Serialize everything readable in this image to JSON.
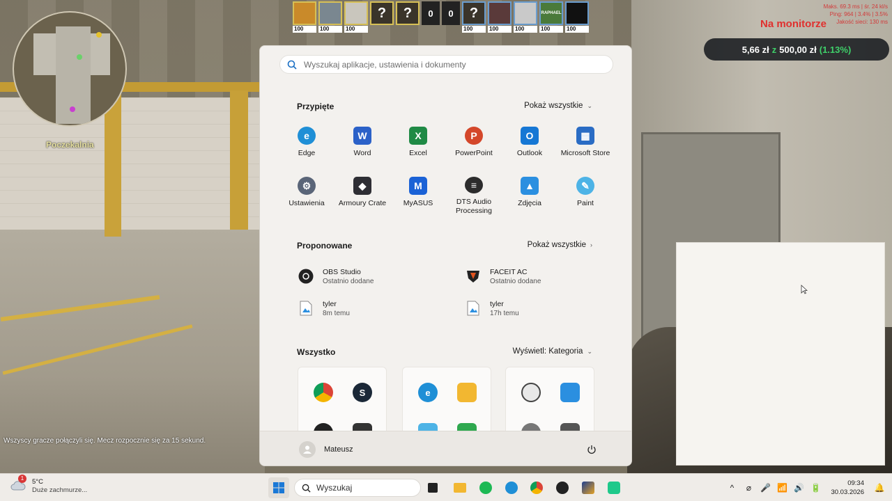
{
  "game": {
    "map_location": "Poczekalnia",
    "scoreboard": {
      "t_avatars": [
        "",
        "",
        "",
        "?",
        "?"
      ],
      "score_t": "0",
      "score_ct": "0",
      "ct_avatars": [
        "?",
        "",
        "",
        "RAPHAEL",
        ""
      ],
      "hp": "100"
    },
    "net_stats": [
      "Maks. 69.3 ms | śr. 24 kl/s",
      "Ping: 964 | 3.4% | 3.5%",
      "Jakość sieci: 130 ms"
    ],
    "live_overlay": "Na monitorze",
    "donation": {
      "current": "5,66 zł",
      "of": "z",
      "goal": "500,00 zł",
      "percent": "(1.13%)"
    },
    "chat_message": "Wszyscy gracze połączyli się. Mecz rozpocznie się za 15 sekund."
  },
  "start_menu": {
    "search": {
      "placeholder": "Wyszukaj aplikacje, ustawienia i dokumenty"
    },
    "pinned": {
      "title": "Przypięte",
      "action": "Pokaż wszystkie",
      "apps": [
        {
          "label": "Edge",
          "icon": "edge-icon",
          "color": "#1f8fd6"
        },
        {
          "label": "Word",
          "icon": "word-icon",
          "color": "#2b61c8"
        },
        {
          "label": "Excel",
          "icon": "excel-icon",
          "color": "#1f8a45"
        },
        {
          "label": "PowerPoint",
          "icon": "powerpoint-icon",
          "color": "#d4472a"
        },
        {
          "label": "Outlook",
          "icon": "outlook-icon",
          "color": "#1677d4"
        },
        {
          "label": "Microsoft Store",
          "icon": "store-icon",
          "color": "#2a6cc4"
        },
        {
          "label": "Ustawienia",
          "icon": "gear-icon",
          "color": "#5a6578"
        },
        {
          "label": "Armoury Crate",
          "icon": "armoury-crate-icon",
          "color": "#2e2e34"
        },
        {
          "label": "MyASUS",
          "icon": "myasus-icon",
          "color": "#1b62d6"
        },
        {
          "label": "DTS Audio Processing",
          "icon": "dts-icon",
          "color": "#2c2c2c"
        },
        {
          "label": "Zdjęcia",
          "icon": "photos-icon",
          "color": "#2b8fe0"
        },
        {
          "label": "Paint",
          "icon": "paint-icon",
          "color": "#4db3e6"
        }
      ]
    },
    "recommended": {
      "title": "Proponowane",
      "action": "Pokaż wszystkie",
      "items": [
        {
          "name": "OBS Studio",
          "sub": "Ostatnio dodane",
          "icon": "obs-icon"
        },
        {
          "name": "FACEIT AC",
          "sub": "Ostatnio dodane",
          "icon": "faceit-icon"
        },
        {
          "name": "tyler",
          "sub": "8m temu",
          "icon": "image-file-icon"
        },
        {
          "name": "tyler",
          "sub": "17h temu",
          "icon": "image-file-icon"
        }
      ]
    },
    "all": {
      "title": "Wszystko",
      "action": "Wyświetl: Kategoria"
    },
    "user": {
      "name": "Mateusz"
    }
  },
  "taskbar": {
    "weather": {
      "temp": "5°C",
      "desc": "Duże zachmurze...",
      "badge": "1"
    },
    "search_label": "Wyszukaj",
    "time": "09:34",
    "date": "30.03.2026"
  }
}
